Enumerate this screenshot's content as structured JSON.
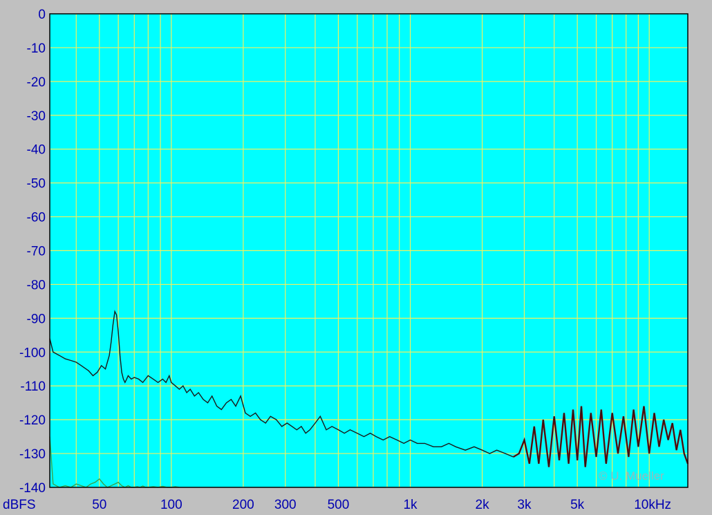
{
  "chart_data": {
    "type": "line",
    "ylabel": "dBFS",
    "ylim": [
      -140,
      0
    ],
    "y_ticks": [
      "0",
      "-10",
      "-20",
      "-30",
      "-40",
      "-50",
      "-60",
      "-70",
      "-80",
      "-90",
      "-100",
      "-110",
      "-120",
      "-130",
      "-140"
    ],
    "x_scale": "log",
    "xlim_hz": [
      31,
      14500
    ],
    "x_tick_values": [
      50,
      100,
      200,
      300,
      500,
      1000,
      2000,
      3000,
      5000,
      10000
    ],
    "x_tick_labels": [
      "50",
      "100",
      "200",
      "300",
      "500",
      "1k",
      "2k",
      "3k",
      "5k",
      "10kHz"
    ],
    "grid": true,
    "colors": {
      "plot_background": "#00ffff",
      "grid": "#f0f060",
      "frame": "#c0c0c0",
      "axis_text": "#0000b0",
      "trace": "#1a1a1a",
      "trace_hf": "#8b0000",
      "floor_trace": "#3aa34a"
    },
    "series": [
      {
        "x": [
          31,
          32,
          34,
          36,
          38,
          40,
          42,
          44,
          45,
          47,
          49,
          51,
          53,
          54,
          55,
          56,
          57,
          58,
          59,
          60,
          61,
          62,
          63,
          64,
          65,
          66,
          68,
          70,
          73,
          76,
          80,
          84,
          88,
          92,
          95,
          98,
          100,
          104,
          108,
          112,
          116,
          120,
          125,
          130,
          136,
          142,
          148,
          155,
          162,
          170,
          178,
          186,
          195,
          204,
          214,
          225,
          236,
          248,
          260,
          275,
          290,
          305,
          320,
          335,
          350,
          365,
          380,
          400,
          420,
          445,
          470,
          500,
          530,
          560,
          600,
          640,
          680,
          720,
          770,
          820,
          880,
          940,
          1000,
          1070,
          1150,
          1250,
          1350,
          1450,
          1550,
          1700,
          1850,
          2000,
          2150,
          2300,
          2500,
          2700,
          2850,
          3000,
          3150,
          3300,
          3450,
          3600,
          3800,
          4000,
          4200,
          4400,
          4600,
          4800,
          5000,
          5200,
          5400,
          5700,
          6000,
          6300,
          6600,
          7000,
          7400,
          7800,
          8200,
          8600,
          9000,
          9500,
          10000,
          10500,
          11000,
          11500,
          12000,
          12500,
          13000,
          13500,
          14000,
          14500
        ],
        "y": [
          -96,
          -100,
          -101,
          -102,
          -102.5,
          -103,
          -104,
          -105,
          -105.5,
          -107,
          -106,
          -104,
          -105,
          -103,
          -101,
          -97,
          -92,
          -88,
          -89,
          -94,
          -101,
          -106,
          -108,
          -109,
          -108,
          -107,
          -108,
          -107.5,
          -108,
          -109,
          -107,
          -108,
          -109,
          -108,
          -109,
          -107,
          -109,
          -110,
          -111,
          -110,
          -112,
          -111,
          -113,
          -112,
          -114,
          -115,
          -113,
          -116,
          -117,
          -115,
          -114,
          -116,
          -113,
          -118,
          -119,
          -118,
          -120,
          -121,
          -119,
          -120,
          -122,
          -121,
          -122,
          -123,
          -122,
          -124,
          -123,
          -121,
          -119,
          -123,
          -122,
          -123,
          -124,
          -123,
          -124,
          -125,
          -124,
          -125,
          -126,
          -125,
          -126,
          -127,
          -126,
          -127,
          -127,
          -128,
          -128,
          -127,
          -128,
          -129,
          -128,
          -129,
          -130,
          -129,
          -130,
          -131,
          -130,
          -126,
          -133,
          -122,
          -133,
          -120,
          -134,
          -119,
          -132,
          -118,
          -133,
          -117,
          -132,
          -116,
          -134,
          -118,
          -131,
          -117,
          -133,
          -118,
          -130,
          -119,
          -131,
          -117,
          -128,
          -116,
          -130,
          -118,
          -128,
          -120,
          -126,
          -121,
          -129,
          -123,
          -130,
          -133
        ]
      },
      {
        "x": [
          31,
          32,
          34,
          36,
          38,
          40,
          42,
          44,
          46,
          48,
          50,
          52,
          54,
          56,
          58,
          60,
          62,
          64,
          66,
          68,
          70,
          72,
          74,
          76,
          78,
          80,
          84,
          88,
          92,
          96,
          100,
          104,
          108
        ],
        "y": [
          -125,
          -139,
          -140,
          -139.5,
          -140,
          -139,
          -139.5,
          -140,
          -139,
          -138.5,
          -137.5,
          -139,
          -140,
          -139.5,
          -139,
          -138.5,
          -139.5,
          -140,
          -139.5,
          -140,
          -140,
          -139.8,
          -140,
          -139.6,
          -140,
          -140,
          -139.8,
          -140,
          -139.7,
          -140,
          -140,
          -139.8,
          -140
        ]
      }
    ]
  },
  "watermark": "© U. Mueller"
}
